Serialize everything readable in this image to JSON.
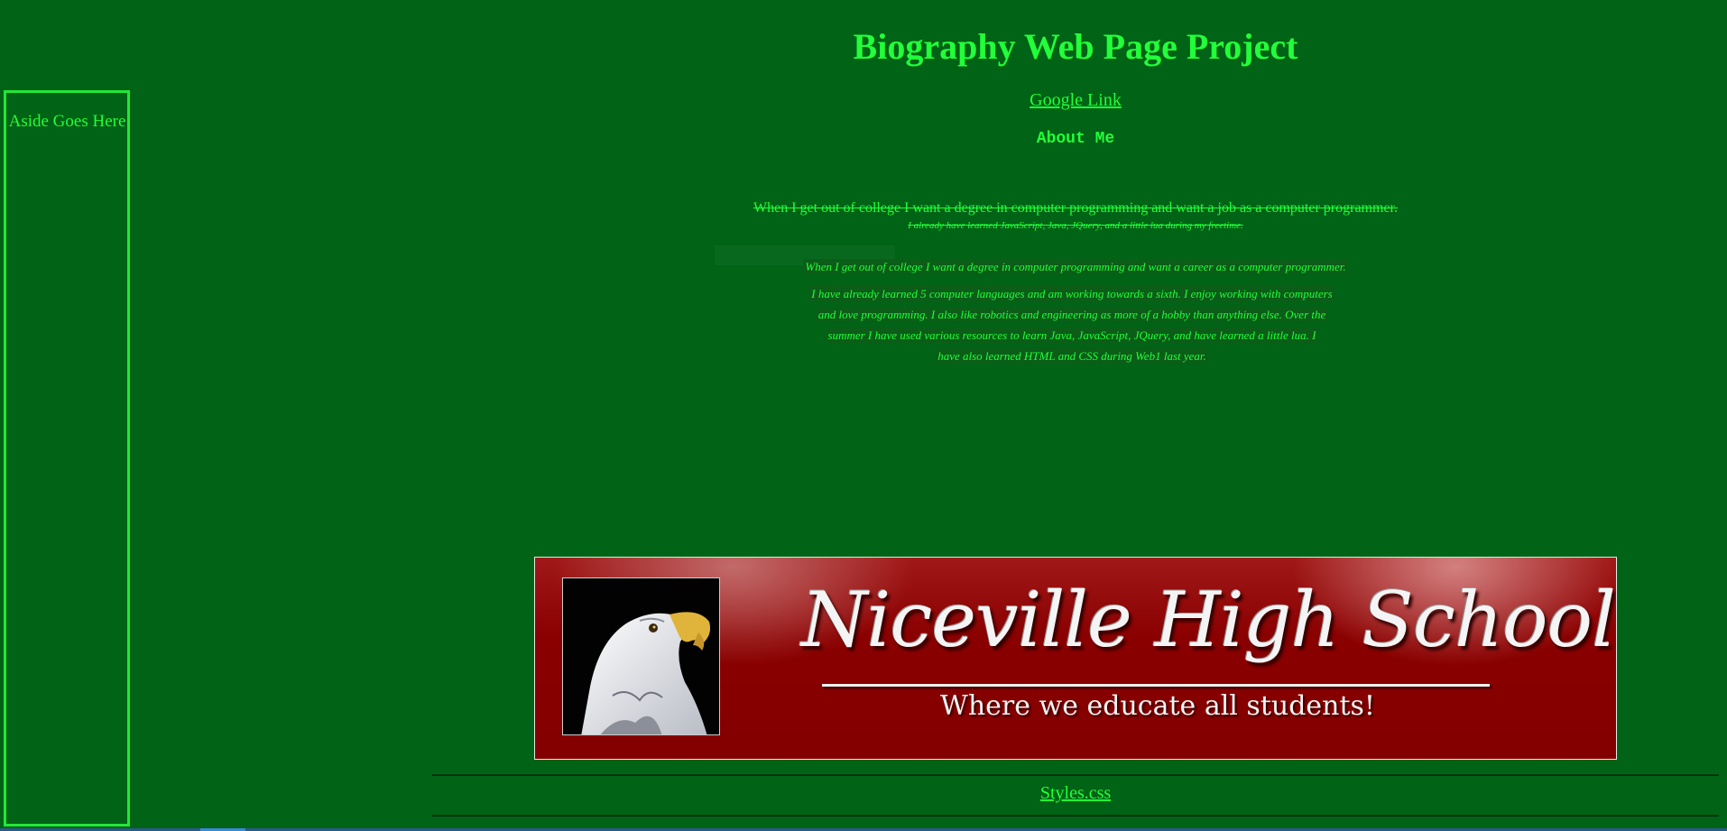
{
  "aside": {
    "label": "Aside Goes Here"
  },
  "header": {
    "title": "Biography Web Page Project",
    "google_link": "Google Link",
    "about_heading": "About Me"
  },
  "struck": {
    "main": "When I get out of college I want a degree in computer programming and want a job as a computer programmer.",
    "sub": "I already have learned JavaScript, Java, JQuery, and a little lua during my freetime."
  },
  "content": {
    "career_line": "When I get out of college I want a degree in computer programming and want a career as a computer programmer.",
    "paragraph_lines": [
      "I have already learned 5 computer languages and am working towards a sixth. I enjoy working with computers",
      "and love programming. I also like robotics and engineering as more of a hobby than anything else. Over the",
      "summer I have used various resources to learn Java, JavaScript, JQuery, and have learned a little lua. I",
      "have also learned HTML and CSS during Web1 last year."
    ]
  },
  "banner": {
    "school_name": "Niceville High School",
    "tagline": "Where we educate all students!",
    "colors": {
      "background": "#8a0000",
      "text": "#f4f4f4"
    }
  },
  "footer": {
    "styles_link": "Styles.css"
  },
  "colors": {
    "page_bg": "#006315",
    "text": "#22ff3a"
  }
}
